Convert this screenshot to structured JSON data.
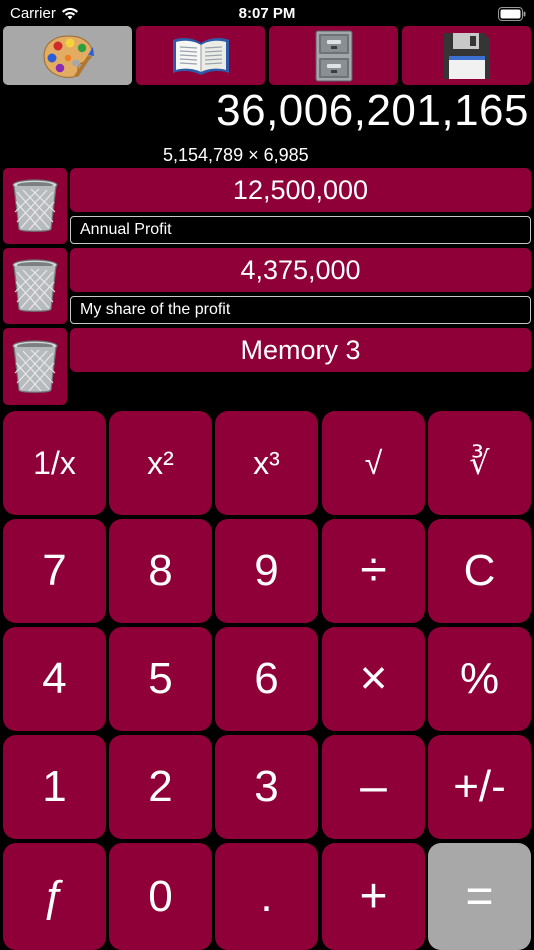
{
  "status_bar": {
    "carrier": "Carrier",
    "time": "8:07 PM",
    "icons": [
      "wifi-icon",
      "battery-icon"
    ]
  },
  "toolbar": {
    "buttons": [
      {
        "icon": "palette-icon",
        "selected": true
      },
      {
        "icon": "open-book-icon",
        "selected": false
      },
      {
        "icon": "file-cabinet-icon",
        "selected": false
      },
      {
        "icon": "floppy-disk-icon",
        "selected": false
      }
    ]
  },
  "display": {
    "result": "36,006,201,165",
    "expression": "5,154,789 × 6,985"
  },
  "memories": [
    {
      "value": "12,500,000",
      "label": "Annual Profit",
      "icon": "trash-can-icon"
    },
    {
      "value": "4,375,000",
      "label": "My share of the profit",
      "icon": "trash-can-icon"
    },
    {
      "value": "Memory 3",
      "icon": "trash-can-icon"
    }
  ],
  "keypad": {
    "rows": [
      [
        "1/x",
        "x²",
        "x³",
        "√",
        "∛"
      ],
      [
        "7",
        "8",
        "9",
        "÷",
        "C"
      ],
      [
        "4",
        "5",
        "6",
        "×",
        "%"
      ],
      [
        "1",
        "2",
        "3",
        "–",
        "+/-"
      ],
      [
        "ƒ",
        "0",
        ".",
        "+",
        "="
      ]
    ]
  },
  "colors": {
    "background": "#000000",
    "button": "#8f0038",
    "selected_button": "#a8a8a8",
    "equals_button": "#a8a8a8",
    "text": "#ffffff"
  }
}
